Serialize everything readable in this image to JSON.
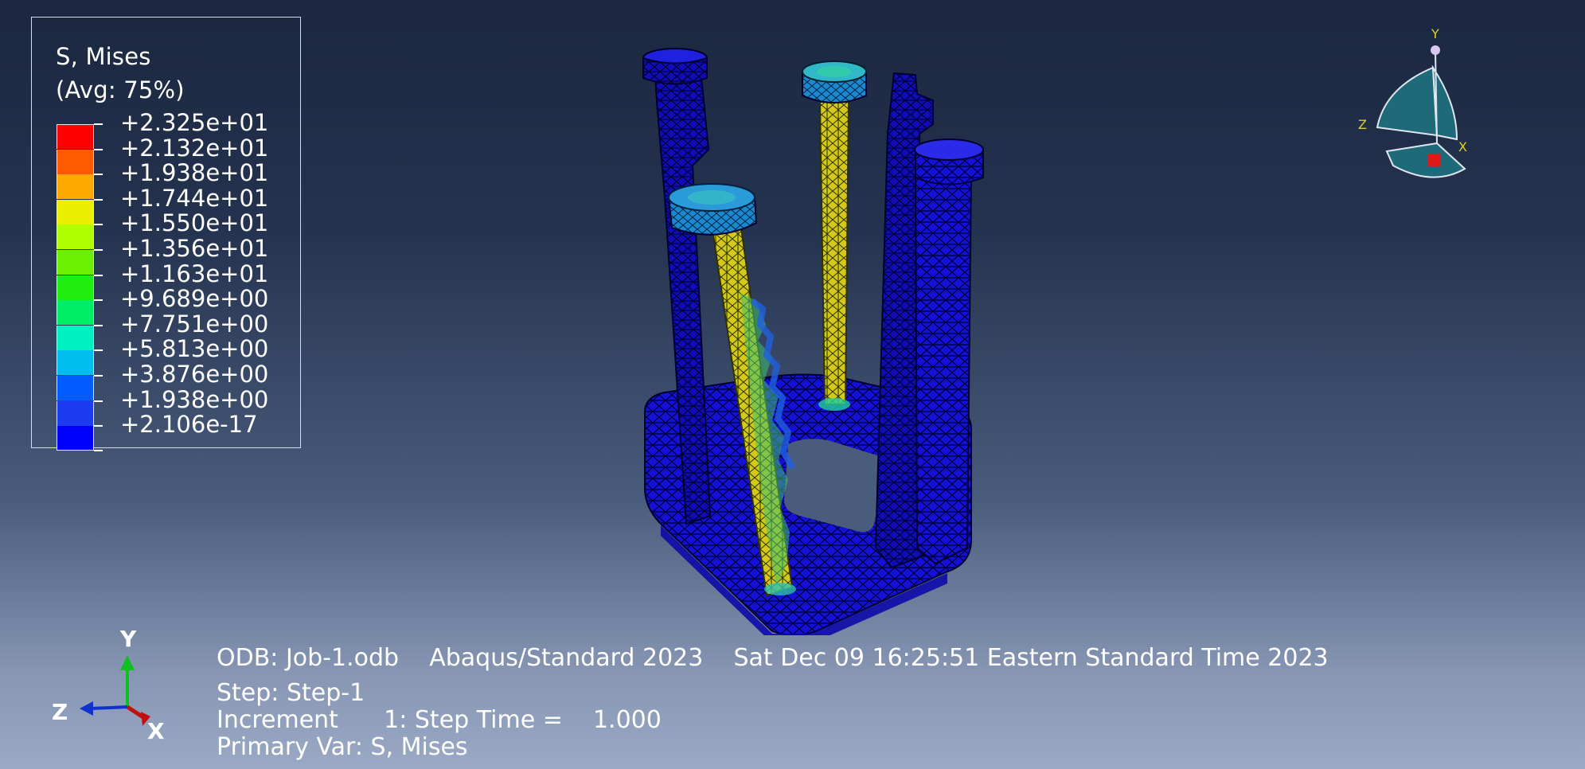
{
  "legend": {
    "title": "S, Mises",
    "subtitle": "(Avg: 75%)",
    "levels": [
      {
        "value": "+2.325e+01",
        "color": "#ff0000"
      },
      {
        "value": "+2.132e+01",
        "color": "#ff5a00"
      },
      {
        "value": "+1.938e+01",
        "color": "#ffaa00"
      },
      {
        "value": "+1.744e+01",
        "color": "#eaf000"
      },
      {
        "value": "+1.550e+01",
        "color": "#b0ff00"
      },
      {
        "value": "+1.356e+01",
        "color": "#6af000"
      },
      {
        "value": "+1.163e+01",
        "color": "#20ee10"
      },
      {
        "value": "+9.689e+00",
        "color": "#00ee66"
      },
      {
        "value": "+7.751e+00",
        "color": "#00f0c0"
      },
      {
        "value": "+5.813e+00",
        "color": "#00bff0"
      },
      {
        "value": "+3.876e+00",
        "color": "#005cff"
      },
      {
        "value": "+1.938e+00",
        "color": "#1d3cf0"
      },
      {
        "value": "+2.106e-17",
        "color": "#0000ff"
      }
    ]
  },
  "view_cube": {
    "y": "Y",
    "z": "Z",
    "x": "X"
  },
  "triad": {
    "y": "Y",
    "z": "Z",
    "x": "X"
  },
  "info": {
    "odb": "ODB: Job-1.odb    Abaqus/Standard 2023    Sat Dec 09 16:25:51 Eastern Standard Time 2023",
    "step": "Step: Step-1",
    "increment": "Increment      1: Step Time =    1.000",
    "primary_var": "Primary Var: S, Mises"
  },
  "colors": {
    "mesh_blue": "#1410d8",
    "mesh_edge": "#000030",
    "bolt_yellow": "#d6c816"
  }
}
